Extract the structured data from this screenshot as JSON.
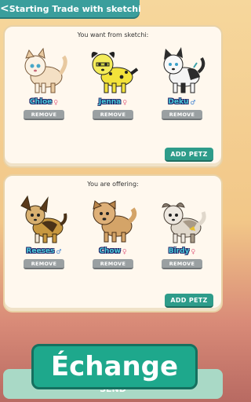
{
  "header": {
    "back_label": "<",
    "title": "Starting Trade with sketchi"
  },
  "want_panel": {
    "heading": "You want from sketchi:",
    "add_label": "ADD PETZ",
    "pets": [
      {
        "name": "Chloe",
        "sex": "♀",
        "sex_type": "f",
        "remove_label": "REMOVE"
      },
      {
        "name": "Jenna",
        "sex": "♀",
        "sex_type": "f",
        "remove_label": "REMOVE"
      },
      {
        "name": "Deku",
        "sex": "♂",
        "sex_type": "m",
        "remove_label": "REMOVE"
      }
    ]
  },
  "offer_panel": {
    "heading": "You are offering:",
    "add_label": "ADD PETZ",
    "pets": [
      {
        "name": "Reeses",
        "sex": "♂",
        "sex_type": "m",
        "remove_label": "REMOVE"
      },
      {
        "name": "Chow",
        "sex": "♀",
        "sex_type": "f",
        "remove_label": "REMOVE"
      },
      {
        "name": "Birdy",
        "sex": "♀",
        "sex_type": "f",
        "remove_label": "REMOVE"
      }
    ]
  },
  "send_label": "SEND",
  "overlay_label": "Échange",
  "colors": {
    "accent": "#1ea88c",
    "header": "#3a9e9c",
    "name_text": "#48c8d8"
  }
}
